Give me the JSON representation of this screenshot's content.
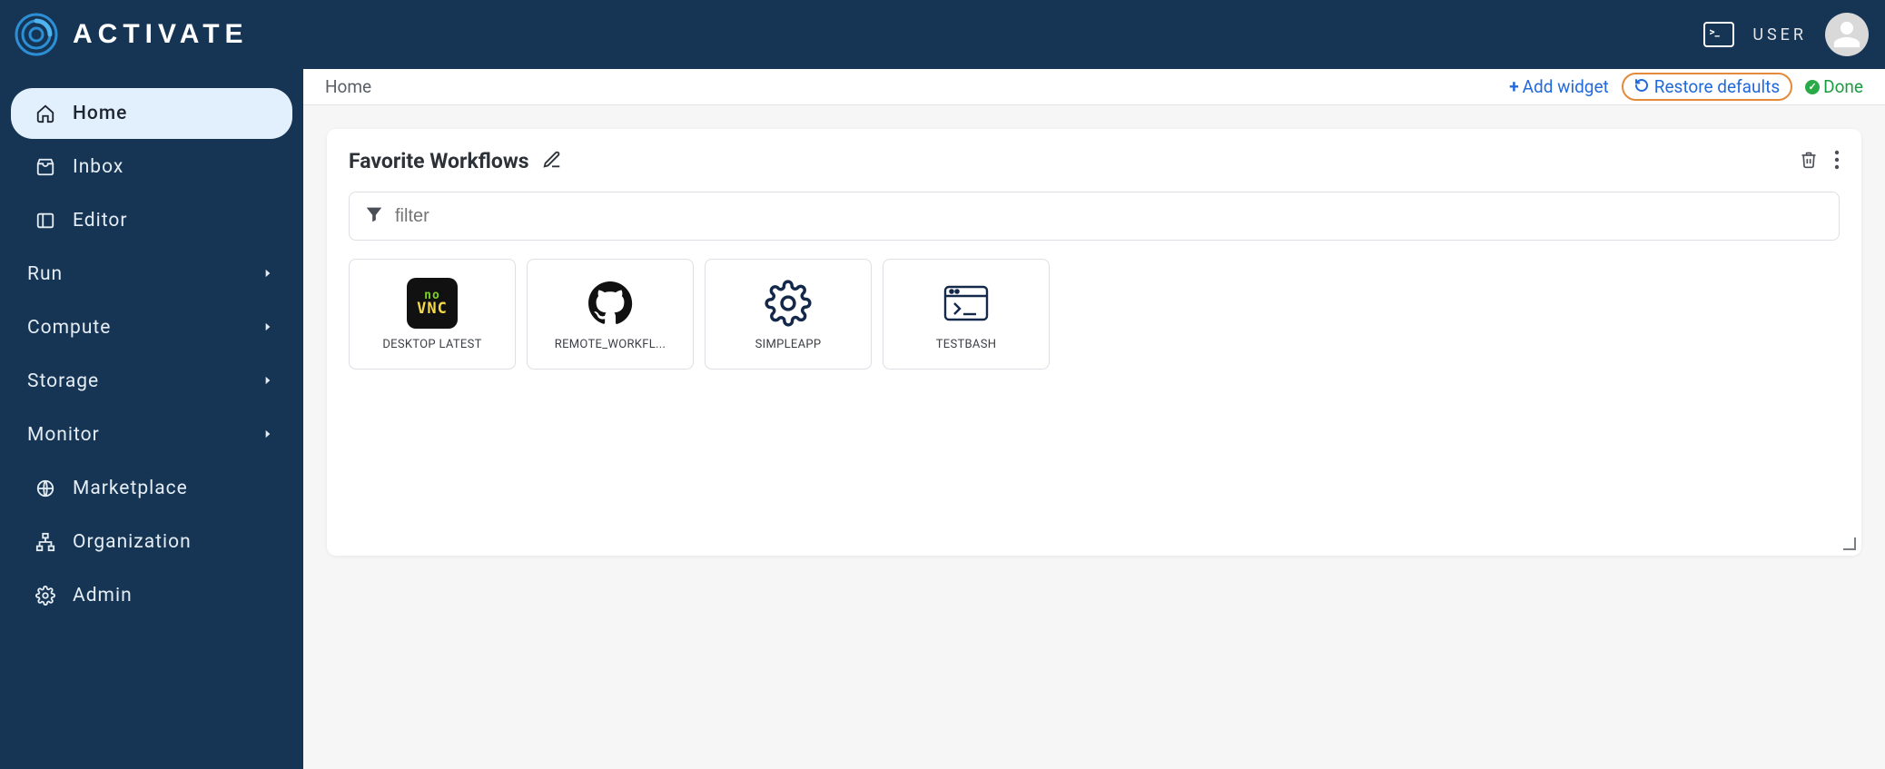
{
  "brand": {
    "name": "ACTIVATE"
  },
  "header": {
    "user_label": "USER"
  },
  "sidebar": {
    "items": [
      {
        "label": "Home"
      },
      {
        "label": "Inbox"
      },
      {
        "label": "Editor"
      }
    ],
    "groups": [
      {
        "label": "Run"
      },
      {
        "label": "Compute"
      },
      {
        "label": "Storage"
      },
      {
        "label": "Monitor"
      }
    ],
    "footer": [
      {
        "label": "Marketplace"
      },
      {
        "label": "Organization"
      },
      {
        "label": "Admin"
      }
    ]
  },
  "breadcrumb": {
    "title": "Home",
    "add_widget": "Add widget",
    "restore_defaults": "Restore defaults",
    "done": "Done"
  },
  "card": {
    "title": "Favorite Workflows",
    "filter_placeholder": "filter",
    "tiles": [
      {
        "label": "DESKTOP LATEST"
      },
      {
        "label": "REMOTE_WORKFL..."
      },
      {
        "label": "SIMPLEAPP"
      },
      {
        "label": "TESTBASH"
      }
    ]
  },
  "icons": {
    "home": "home-icon",
    "inbox": "inbox-icon",
    "editor": "panel-icon",
    "marketplace": "globe-icon",
    "organization": "org-icon",
    "admin": "gear-icon"
  }
}
